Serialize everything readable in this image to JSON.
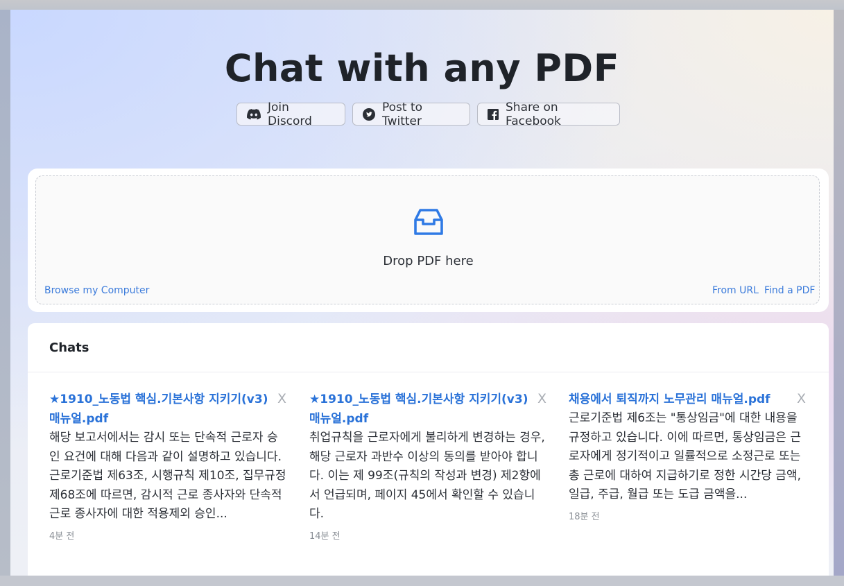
{
  "header": {
    "title": "Chat with any PDF"
  },
  "social": [
    {
      "label": "Join Discord",
      "icon": "discord-icon"
    },
    {
      "label": "Post to Twitter",
      "icon": "twitter-icon"
    },
    {
      "label": "Share on Facebook",
      "icon": "facebook-icon"
    }
  ],
  "upload": {
    "drop_label": "Drop PDF here",
    "browse_label": "Browse my Computer",
    "from_url_label": "From URL",
    "find_pdf_label": "Find a PDF",
    "icon": "inbox-icon",
    "accent_color": "#2f7ae5"
  },
  "chats": {
    "title": "Chats",
    "close_glyph": "X",
    "items": [
      {
        "name": "★1910_노동법 핵심.기본사항 지키기(v3) 매뉴얼.pdf",
        "snippet": "해당 보고서에서는 감시 또는 단속적 근로자 승인 요건에 대해 다음과 같이 설명하고 있습니다. 근로기준법 제63조, 시행규칙 제10조, 집무규정 제68조에 따르면, 감시적 근로 종사자와 단속적 근로 종사자에 대한 적용제외 승인...",
        "time": "4분 전"
      },
      {
        "name": "★1910_노동법 핵심.기본사항 지키기(v3) 매뉴얼.pdf",
        "snippet": "취업규칙을 근로자에게 불리하게 변경하는 경우, 해당 근로자 과반수 이상의 동의를 받아야 합니다. 이는 제 99조(규칙의 작성과 변경) 제2항에서 언급되며, 페이지 45에서 확인할 수 있습니다.",
        "time": "14분 전"
      },
      {
        "name": "채용에서 퇴직까지 노무관리 매뉴얼.pdf",
        "snippet": "근로기준법 제6조는 \"통상임금\"에 대한 내용을 규정하고 있습니다. 이에 따르면, 통상임금은 근로자에게 정기적이고 일률적으로 소정근로 또는 총 근로에 대하여 지급하기로 정한 시간당 금액, 일급, 주급, 월급 또는 도급 금액을...",
        "time": "18분 전"
      }
    ]
  }
}
